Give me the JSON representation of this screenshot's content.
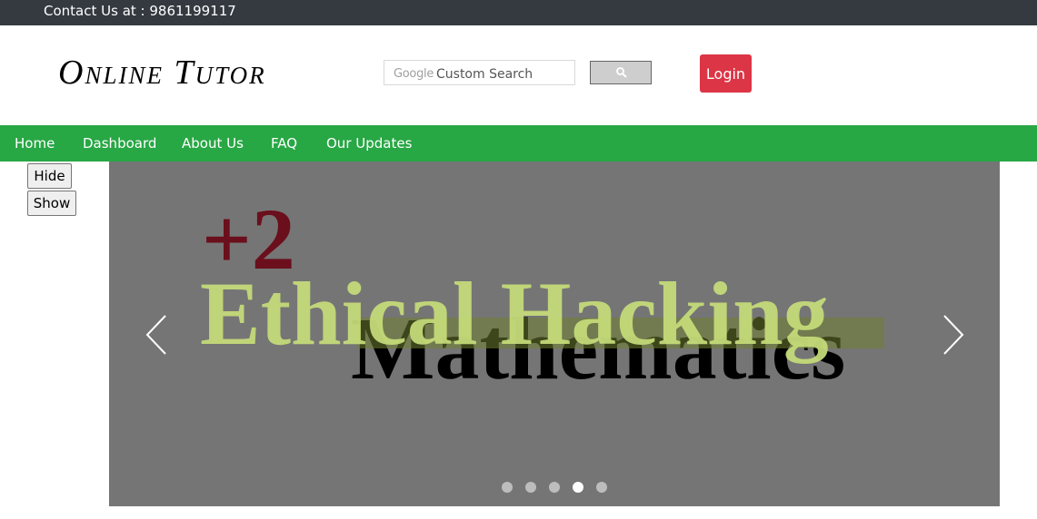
{
  "topbar": {
    "contact": "Contact Us at : 9861199117"
  },
  "header": {
    "logo": "Online Tutor",
    "search": {
      "brand": "Google",
      "placeholder": "Custom Search"
    },
    "login_label": "Login"
  },
  "nav": {
    "items": [
      "Home",
      "Dashboard",
      "About Us",
      "FAQ",
      "Our Updates"
    ]
  },
  "side_buttons": {
    "hide": "Hide",
    "show": "Show"
  },
  "carousel": {
    "slide_texts": {
      "plus2": "+2",
      "math": "Mathematics",
      "hacking": "Ethical Hacking"
    },
    "dots_count": 5,
    "active_dot": 4
  },
  "colors": {
    "topbar": "#343a40",
    "nav": "#28a745",
    "login": "#dc3545",
    "carousel_bg": "#757575"
  }
}
